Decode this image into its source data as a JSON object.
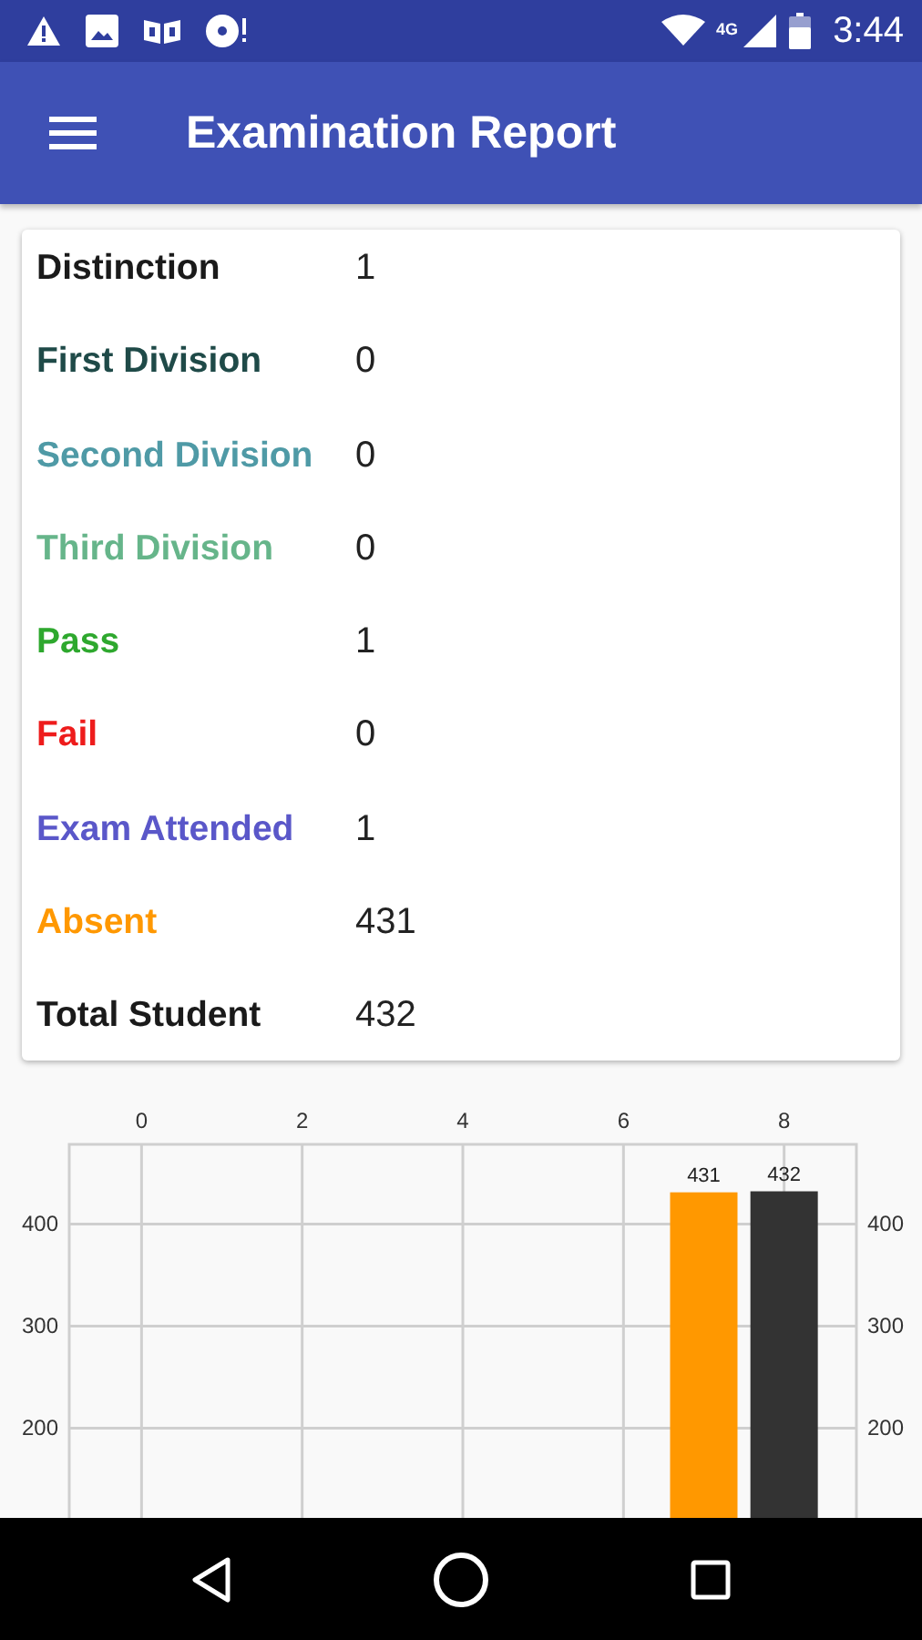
{
  "status_bar": {
    "network": "4G",
    "time": "3:44"
  },
  "app_bar": {
    "title": "Examination Report"
  },
  "summary": [
    {
      "label": "Distinction",
      "value": "1",
      "color": "#1a1a1a"
    },
    {
      "label": "First Division",
      "value": "0",
      "color": "#1f4a48"
    },
    {
      "label": "Second Division",
      "value": "0",
      "color": "#4f9aa6"
    },
    {
      "label": "Third Division",
      "value": "0",
      "color": "#66b58a"
    },
    {
      "label": "Pass",
      "value": "1",
      "color": "#2ea82e"
    },
    {
      "label": "Fail",
      "value": "0",
      "color": "#ee1c1c"
    },
    {
      "label": "Exam Attended",
      "value": "1",
      "color": "#5a57c9"
    },
    {
      "label": "Absent",
      "value": "431",
      "color": "#ff9800"
    },
    {
      "label": "Total Student",
      "value": "432",
      "color": "#1a1a1a"
    }
  ],
  "chart": {
    "chart_data": {
      "type": "bar",
      "x": [
        7,
        8
      ],
      "series": [
        {
          "color": "#ff9800",
          "values": [
            431,
            null
          ]
        },
        {
          "color": "#333333",
          "values": [
            null,
            432
          ]
        }
      ],
      "xlim": [
        -0.9,
        8.9
      ],
      "ylim": [
        112,
        478
      ],
      "xticks": [
        0,
        2,
        4,
        6,
        8
      ],
      "yticks": [
        200,
        300,
        400
      ],
      "grid": true,
      "data_labels": true
    },
    "left_axis_labels": [
      "400",
      "300",
      "200"
    ],
    "right_axis_labels": [
      "400",
      "300",
      "200"
    ]
  }
}
